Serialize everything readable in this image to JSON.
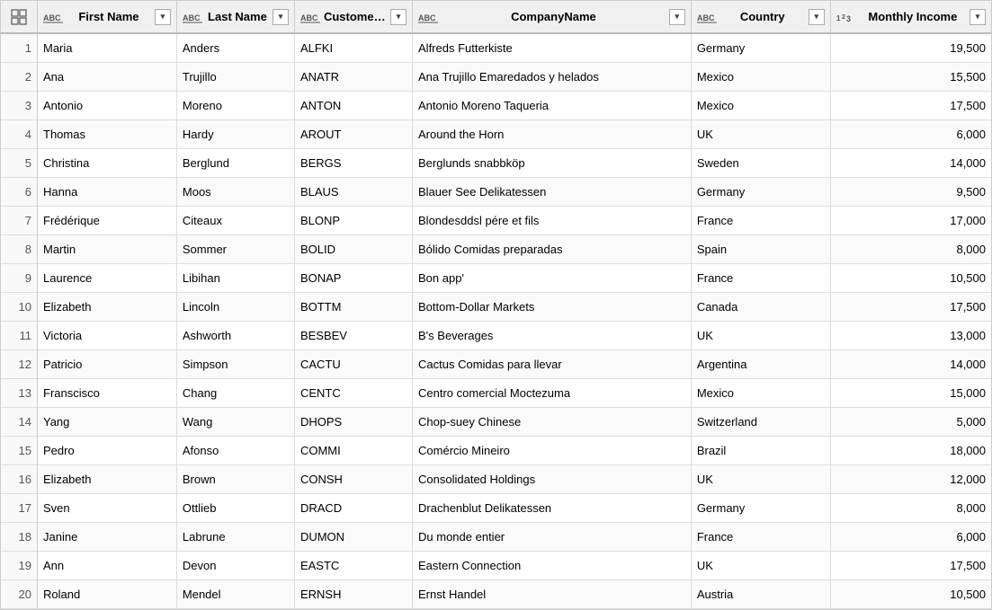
{
  "columns": [
    {
      "id": "rownum",
      "label": "",
      "type": "rownum",
      "icon": "grid"
    },
    {
      "id": "firstname",
      "label": "First Name",
      "type": "text",
      "icon": "abc"
    },
    {
      "id": "lastname",
      "label": "Last Name",
      "type": "text",
      "icon": "abc"
    },
    {
      "id": "customerid",
      "label": "CustomerID",
      "type": "text",
      "icon": "abc"
    },
    {
      "id": "companyname",
      "label": "CompanyName",
      "type": "text",
      "icon": "abc"
    },
    {
      "id": "country",
      "label": "Country",
      "type": "text",
      "icon": "abc"
    },
    {
      "id": "income",
      "label": "Monthly Income",
      "type": "number",
      "icon": "123"
    }
  ],
  "rows": [
    {
      "rownum": 1,
      "firstname": "Maria",
      "lastname": "Anders",
      "customerid": "ALFKI",
      "companyname": "Alfreds Futterkiste",
      "country": "Germany",
      "income": 19500
    },
    {
      "rownum": 2,
      "firstname": "Ana",
      "lastname": "Trujillo",
      "customerid": "ANATR",
      "companyname": "Ana Trujillo Emaredados y helados",
      "country": "Mexico",
      "income": 15500
    },
    {
      "rownum": 3,
      "firstname": "Antonio",
      "lastname": "Moreno",
      "customerid": "ANTON",
      "companyname": "Antonio Moreno Taqueria",
      "country": "Mexico",
      "income": 17500
    },
    {
      "rownum": 4,
      "firstname": "Thomas",
      "lastname": "Hardy",
      "customerid": "AROUT",
      "companyname": "Around the Horn",
      "country": "UK",
      "income": 6000
    },
    {
      "rownum": 5,
      "firstname": "Christina",
      "lastname": "Berglund",
      "customerid": "BERGS",
      "companyname": "Berglunds snabbköp",
      "country": "Sweden",
      "income": 14000
    },
    {
      "rownum": 6,
      "firstname": "Hanna",
      "lastname": "Moos",
      "customerid": "BLAUS",
      "companyname": "Blauer See Delikatessen",
      "country": "Germany",
      "income": 9500
    },
    {
      "rownum": 7,
      "firstname": "Frédérique",
      "lastname": "Citeaux",
      "customerid": "BLONP",
      "companyname": "Blondesddsl pére et fils",
      "country": "France",
      "income": 17000
    },
    {
      "rownum": 8,
      "firstname": "Martin",
      "lastname": "Sommer",
      "customerid": "BOLID",
      "companyname": "Bólido Comidas preparadas",
      "country": "Spain",
      "income": 8000
    },
    {
      "rownum": 9,
      "firstname": "Laurence",
      "lastname": "Libihan",
      "customerid": "BONAP",
      "companyname": "Bon app'",
      "country": "France",
      "income": 10500
    },
    {
      "rownum": 10,
      "firstname": "Elizabeth",
      "lastname": "Lincoln",
      "customerid": "BOTTM",
      "companyname": "Bottom-Dollar Markets",
      "country": "Canada",
      "income": 17500
    },
    {
      "rownum": 11,
      "firstname": "Victoria",
      "lastname": "Ashworth",
      "customerid": "BESBEV",
      "companyname": "B's Beverages",
      "country": "UK",
      "income": 13000
    },
    {
      "rownum": 12,
      "firstname": "Patricio",
      "lastname": "Simpson",
      "customerid": "CACTU",
      "companyname": "Cactus Comidas para llevar",
      "country": "Argentina",
      "income": 14000
    },
    {
      "rownum": 13,
      "firstname": "Franscisco",
      "lastname": "Chang",
      "customerid": "CENTC",
      "companyname": "Centro comercial Moctezuma",
      "country": "Mexico",
      "income": 15000
    },
    {
      "rownum": 14,
      "firstname": "Yang",
      "lastname": "Wang",
      "customerid": "DHOPS",
      "companyname": "Chop-suey Chinese",
      "country": "Switzerland",
      "income": 5000
    },
    {
      "rownum": 15,
      "firstname": "Pedro",
      "lastname": "Afonso",
      "customerid": "COMMI",
      "companyname": "Comércio Mineiro",
      "country": "Brazil",
      "income": 18000
    },
    {
      "rownum": 16,
      "firstname": "Elizabeth",
      "lastname": "Brown",
      "customerid": "CONSH",
      "companyname": "Consolidated Holdings",
      "country": "UK",
      "income": 12000
    },
    {
      "rownum": 17,
      "firstname": "Sven",
      "lastname": "Ottlieb",
      "customerid": "DRACD",
      "companyname": "Drachenblut Delikatessen",
      "country": "Germany",
      "income": 8000
    },
    {
      "rownum": 18,
      "firstname": "Janine",
      "lastname": "Labrune",
      "customerid": "DUMON",
      "companyname": "Du monde entier",
      "country": "France",
      "income": 6000
    },
    {
      "rownum": 19,
      "firstname": "Ann",
      "lastname": "Devon",
      "customerid": "EASTC",
      "companyname": "Eastern Connection",
      "country": "UK",
      "income": 17500
    },
    {
      "rownum": 20,
      "firstname": "Roland",
      "lastname": "Mendel",
      "customerid": "ERNSH",
      "companyname": "Ernst Handel",
      "country": "Austria",
      "income": 10500
    }
  ],
  "icons": {
    "grid": "⊞",
    "abc": "ABC",
    "123": "123",
    "filter": "▾"
  }
}
